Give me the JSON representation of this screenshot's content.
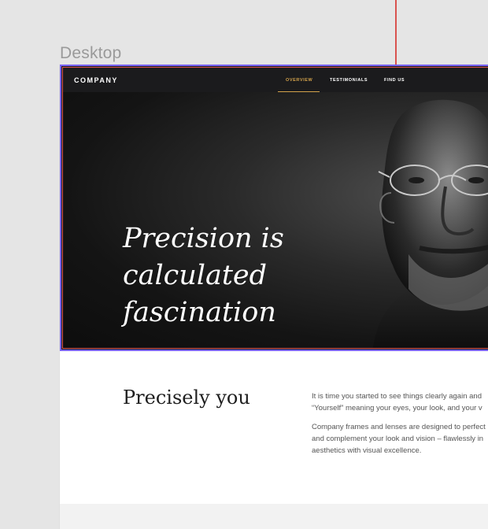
{
  "canvas": {
    "frame_label": "Desktop"
  },
  "site": {
    "brand": "COMPANY",
    "nav": [
      {
        "label": "OVERVIEW",
        "active": true
      },
      {
        "label": "TESTIMONIALS",
        "active": false
      },
      {
        "label": "FIND US",
        "active": false
      }
    ]
  },
  "hero": {
    "title_line_1": "Precision is calculated",
    "title_line_2": "fascination",
    "image": "portrait-photo"
  },
  "intro": {
    "title": "Precisely you",
    "paragraph_1_line_1": "It is time you started to see things clearly again and",
    "paragraph_1_line_2": "“Yourself” meaning your eyes, your look, and your v",
    "paragraph_2_line_1": "Company frames and lenses are designed to perfect",
    "paragraph_2_line_2": "and complement your look and vision – flawlessly in",
    "paragraph_2_line_3": "aesthetics with visual excellence."
  },
  "colors": {
    "selection_outline": "#7a64f5",
    "redline": "#d9534f",
    "nav_active": "#d3a24b",
    "hero_background": "#141414",
    "canvas_background": "#e5e5e5"
  }
}
